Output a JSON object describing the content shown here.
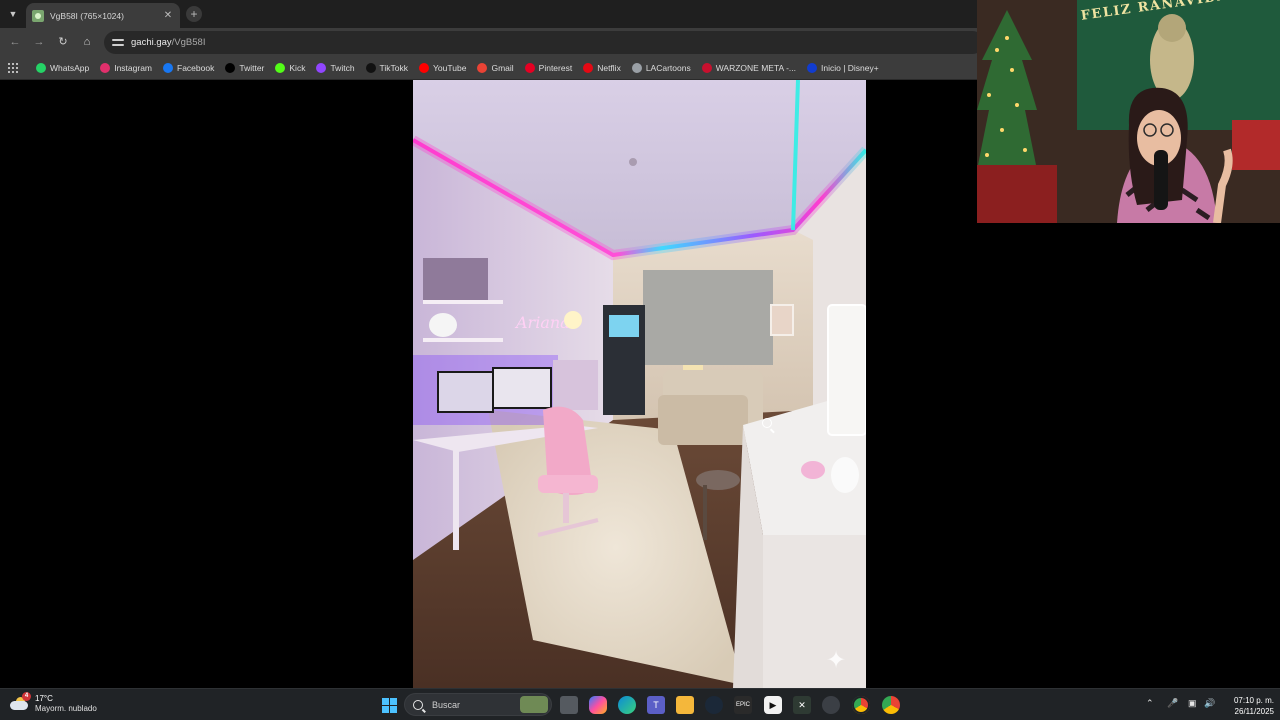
{
  "browser": {
    "tab": {
      "title": "VgB58I (765×1024)"
    },
    "url": {
      "domain": "gachi.gay",
      "path": "/VgB58I"
    },
    "bookmarks": [
      {
        "label": "WhatsApp",
        "icon": "whatsapp-icon",
        "color": "#25d366"
      },
      {
        "label": "Instagram",
        "icon": "instagram-icon",
        "color": "#e1306c"
      },
      {
        "label": "Facebook",
        "icon": "facebook-icon",
        "color": "#1877f2"
      },
      {
        "label": "Twitter",
        "icon": "x-icon",
        "color": "#000000"
      },
      {
        "label": "Kick",
        "icon": "kick-icon",
        "color": "#53fc18"
      },
      {
        "label": "Twitch",
        "icon": "twitch-icon",
        "color": "#9146ff"
      },
      {
        "label": "TikTokk",
        "icon": "tiktok-icon",
        "color": "#111111"
      },
      {
        "label": "YouTube",
        "icon": "youtube-icon",
        "color": "#ff0000"
      },
      {
        "label": "Gmail",
        "icon": "gmail-icon",
        "color": "#ea4335"
      },
      {
        "label": "Pinterest",
        "icon": "pinterest-icon",
        "color": "#e60023"
      },
      {
        "label": "Netflix",
        "icon": "netflix-icon",
        "color": "#e50914"
      },
      {
        "label": "LACartoons",
        "icon": "globe-icon",
        "color": "#9aa0a6"
      },
      {
        "label": "WARZONE META -...",
        "icon": "warzone-icon",
        "color": "#c8102e"
      },
      {
        "label": "Inicio | Disney+",
        "icon": "disney-icon",
        "color": "#113ccf"
      }
    ]
  },
  "webcam": {
    "banner": "FELIZ RANAVIDAD"
  },
  "taskbar": {
    "weather": {
      "temp": "17°C",
      "desc": "Mayorm. nublado",
      "badge": "4"
    },
    "search_placeholder": "Buscar",
    "time": "07:10 p. m.",
    "date": "26/11/2025"
  }
}
